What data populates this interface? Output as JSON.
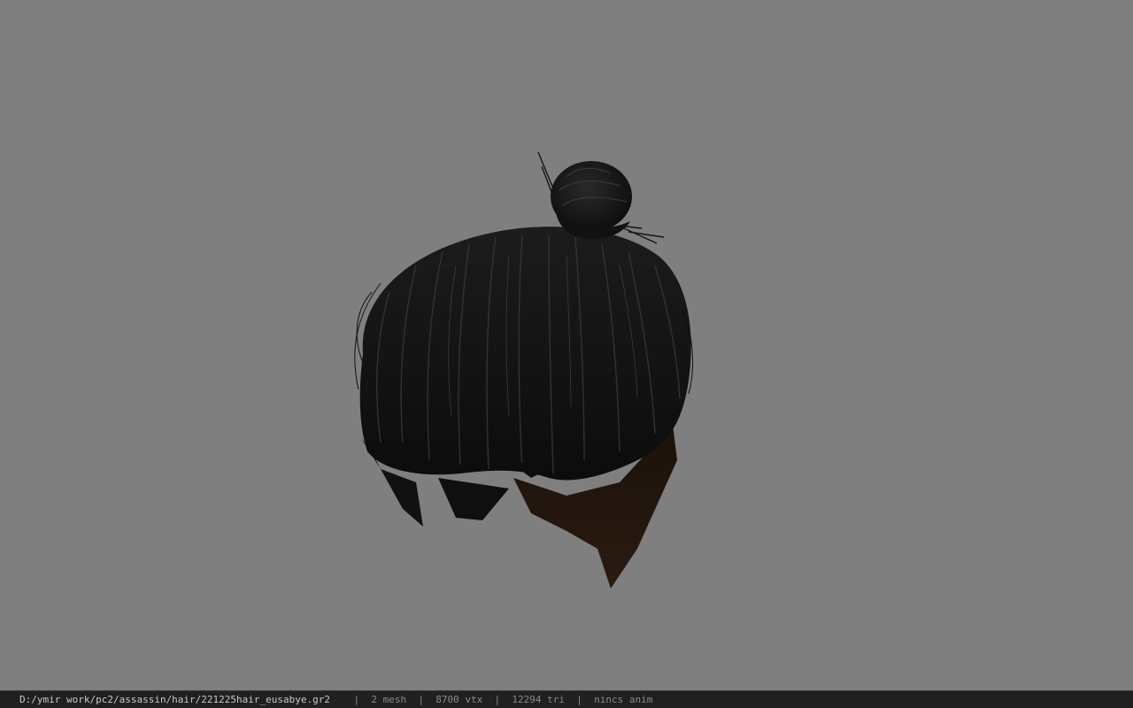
{
  "viewport": {
    "background_color": "#7f7f7f",
    "model_name": "hair-model"
  },
  "status_bar": {
    "file_path": "D:/ymir work/pc2/assassin/hair/221225hair_eusabye.gr2",
    "separator": "|",
    "mesh": "2 mesh",
    "vertices": "8700 vtx",
    "triangles": "12294 tri",
    "anim": "nincs anim"
  }
}
